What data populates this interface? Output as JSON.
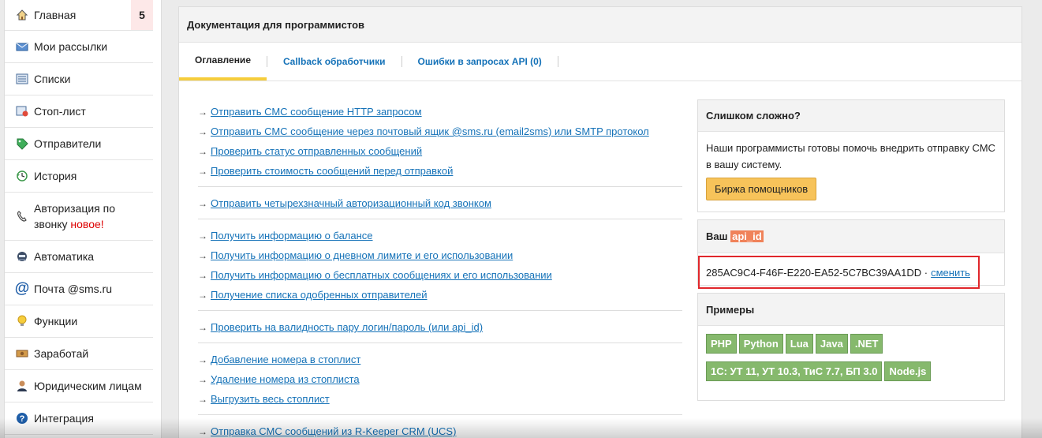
{
  "sidebar": {
    "items": [
      {
        "label": "Главная",
        "icon": "home-icon",
        "badge": "5"
      },
      {
        "label": "Мои рассылки",
        "icon": "mailing-icon"
      },
      {
        "label": "Списки",
        "icon": "list-icon"
      },
      {
        "label": "Стоп-лист",
        "icon": "stoplist-icon"
      },
      {
        "label": "Отправители",
        "icon": "tag-icon"
      },
      {
        "label": "История",
        "icon": "history-icon"
      },
      {
        "label": "Авторизация по",
        "label2": "звонку",
        "new_label": "новое!",
        "icon": "phone-icon"
      },
      {
        "label": "Автоматика",
        "icon": "robot-icon"
      },
      {
        "label": "Почта @sms.ru",
        "icon": "at-icon"
      },
      {
        "label": "Функции",
        "icon": "bulb-icon"
      },
      {
        "label": "Заработай",
        "icon": "money-icon"
      },
      {
        "label": "Юридическим лицам",
        "icon": "person-icon"
      },
      {
        "label": "Интеграция",
        "icon": "help-icon"
      }
    ]
  },
  "panel": {
    "title": "Документация для программистов",
    "tabs": [
      {
        "label": "Оглавление",
        "active": true
      },
      {
        "label": "Callback обработчики"
      },
      {
        "label": "Ошибки в запросах API (0)"
      }
    ]
  },
  "links": {
    "groups": [
      [
        "Отправить СМС сообщение HTTP запросом",
        "Отправить СМС сообщение через почтовый ящик @sms.ru (email2sms) или SMTP протокол",
        "Проверить статус отправленных сообщений",
        "Проверить стоимость сообщений перед отправкой"
      ],
      [
        "Отправить четырехзначный авторизационный код звонком"
      ],
      [
        "Получить информацию о балансе",
        "Получить информацию о дневном лимите и его использовании",
        "Получить информацию о бесплатных сообщениях и его использовании",
        "Получение списка одобренных отправителей"
      ],
      [
        "Проверить на валидность пару логин/пароль (или api_id)"
      ],
      [
        "Добавление номера в стоплист",
        "Удаление номера из стоплиста",
        "Выгрузить весь стоплист"
      ],
      [
        "Отправка СМС сообщений из R-Keeper CRM (UCS)"
      ]
    ]
  },
  "help_box": {
    "title": "Слишком сложно?",
    "text": "Наши программисты готовы помочь внедрить отправку СМС в вашу систему.",
    "button": "Биржа помощников"
  },
  "api_box": {
    "title_prefix": "Ваш",
    "title_hl": "api_id",
    "api_id": "285AC9C4-F46F-E220-EA52-5C7BC39AA1DD",
    "sep": "·",
    "change_label": "сменить"
  },
  "examples_box": {
    "title": "Примеры",
    "row1": [
      "PHP",
      "Python",
      "Lua",
      "Java",
      ".NET"
    ],
    "row2": [
      "1С: УТ 11, УТ 10.3, ТиС 7.7, БП 3.0",
      "Node.js"
    ]
  }
}
